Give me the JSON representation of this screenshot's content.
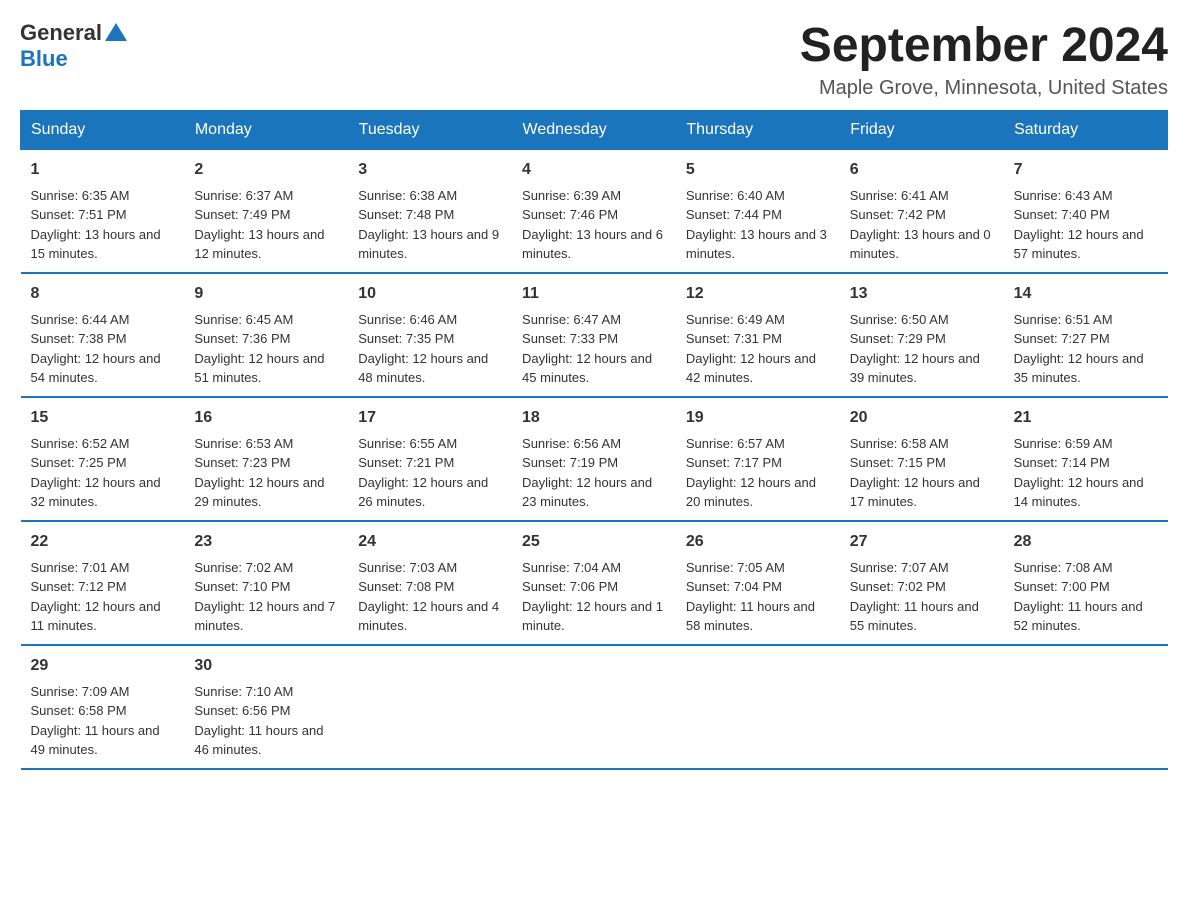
{
  "header": {
    "logo_general": "General",
    "logo_blue": "Blue",
    "title": "September 2024",
    "subtitle": "Maple Grove, Minnesota, United States"
  },
  "weekdays": [
    "Sunday",
    "Monday",
    "Tuesday",
    "Wednesday",
    "Thursday",
    "Friday",
    "Saturday"
  ],
  "weeks": [
    [
      {
        "day": "1",
        "sunrise": "6:35 AM",
        "sunset": "7:51 PM",
        "daylight": "13 hours and 15 minutes."
      },
      {
        "day": "2",
        "sunrise": "6:37 AM",
        "sunset": "7:49 PM",
        "daylight": "13 hours and 12 minutes."
      },
      {
        "day": "3",
        "sunrise": "6:38 AM",
        "sunset": "7:48 PM",
        "daylight": "13 hours and 9 minutes."
      },
      {
        "day": "4",
        "sunrise": "6:39 AM",
        "sunset": "7:46 PM",
        "daylight": "13 hours and 6 minutes."
      },
      {
        "day": "5",
        "sunrise": "6:40 AM",
        "sunset": "7:44 PM",
        "daylight": "13 hours and 3 minutes."
      },
      {
        "day": "6",
        "sunrise": "6:41 AM",
        "sunset": "7:42 PM",
        "daylight": "13 hours and 0 minutes."
      },
      {
        "day": "7",
        "sunrise": "6:43 AM",
        "sunset": "7:40 PM",
        "daylight": "12 hours and 57 minutes."
      }
    ],
    [
      {
        "day": "8",
        "sunrise": "6:44 AM",
        "sunset": "7:38 PM",
        "daylight": "12 hours and 54 minutes."
      },
      {
        "day": "9",
        "sunrise": "6:45 AM",
        "sunset": "7:36 PM",
        "daylight": "12 hours and 51 minutes."
      },
      {
        "day": "10",
        "sunrise": "6:46 AM",
        "sunset": "7:35 PM",
        "daylight": "12 hours and 48 minutes."
      },
      {
        "day": "11",
        "sunrise": "6:47 AM",
        "sunset": "7:33 PM",
        "daylight": "12 hours and 45 minutes."
      },
      {
        "day": "12",
        "sunrise": "6:49 AM",
        "sunset": "7:31 PM",
        "daylight": "12 hours and 42 minutes."
      },
      {
        "day": "13",
        "sunrise": "6:50 AM",
        "sunset": "7:29 PM",
        "daylight": "12 hours and 39 minutes."
      },
      {
        "day": "14",
        "sunrise": "6:51 AM",
        "sunset": "7:27 PM",
        "daylight": "12 hours and 35 minutes."
      }
    ],
    [
      {
        "day": "15",
        "sunrise": "6:52 AM",
        "sunset": "7:25 PM",
        "daylight": "12 hours and 32 minutes."
      },
      {
        "day": "16",
        "sunrise": "6:53 AM",
        "sunset": "7:23 PM",
        "daylight": "12 hours and 29 minutes."
      },
      {
        "day": "17",
        "sunrise": "6:55 AM",
        "sunset": "7:21 PM",
        "daylight": "12 hours and 26 minutes."
      },
      {
        "day": "18",
        "sunrise": "6:56 AM",
        "sunset": "7:19 PM",
        "daylight": "12 hours and 23 minutes."
      },
      {
        "day": "19",
        "sunrise": "6:57 AM",
        "sunset": "7:17 PM",
        "daylight": "12 hours and 20 minutes."
      },
      {
        "day": "20",
        "sunrise": "6:58 AM",
        "sunset": "7:15 PM",
        "daylight": "12 hours and 17 minutes."
      },
      {
        "day": "21",
        "sunrise": "6:59 AM",
        "sunset": "7:14 PM",
        "daylight": "12 hours and 14 minutes."
      }
    ],
    [
      {
        "day": "22",
        "sunrise": "7:01 AM",
        "sunset": "7:12 PM",
        "daylight": "12 hours and 11 minutes."
      },
      {
        "day": "23",
        "sunrise": "7:02 AM",
        "sunset": "7:10 PM",
        "daylight": "12 hours and 7 minutes."
      },
      {
        "day": "24",
        "sunrise": "7:03 AM",
        "sunset": "7:08 PM",
        "daylight": "12 hours and 4 minutes."
      },
      {
        "day": "25",
        "sunrise": "7:04 AM",
        "sunset": "7:06 PM",
        "daylight": "12 hours and 1 minute."
      },
      {
        "day": "26",
        "sunrise": "7:05 AM",
        "sunset": "7:04 PM",
        "daylight": "11 hours and 58 minutes."
      },
      {
        "day": "27",
        "sunrise": "7:07 AM",
        "sunset": "7:02 PM",
        "daylight": "11 hours and 55 minutes."
      },
      {
        "day": "28",
        "sunrise": "7:08 AM",
        "sunset": "7:00 PM",
        "daylight": "11 hours and 52 minutes."
      }
    ],
    [
      {
        "day": "29",
        "sunrise": "7:09 AM",
        "sunset": "6:58 PM",
        "daylight": "11 hours and 49 minutes."
      },
      {
        "day": "30",
        "sunrise": "7:10 AM",
        "sunset": "6:56 PM",
        "daylight": "11 hours and 46 minutes."
      },
      null,
      null,
      null,
      null,
      null
    ]
  ],
  "labels": {
    "sunrise": "Sunrise:",
    "sunset": "Sunset:",
    "daylight": "Daylight:"
  }
}
